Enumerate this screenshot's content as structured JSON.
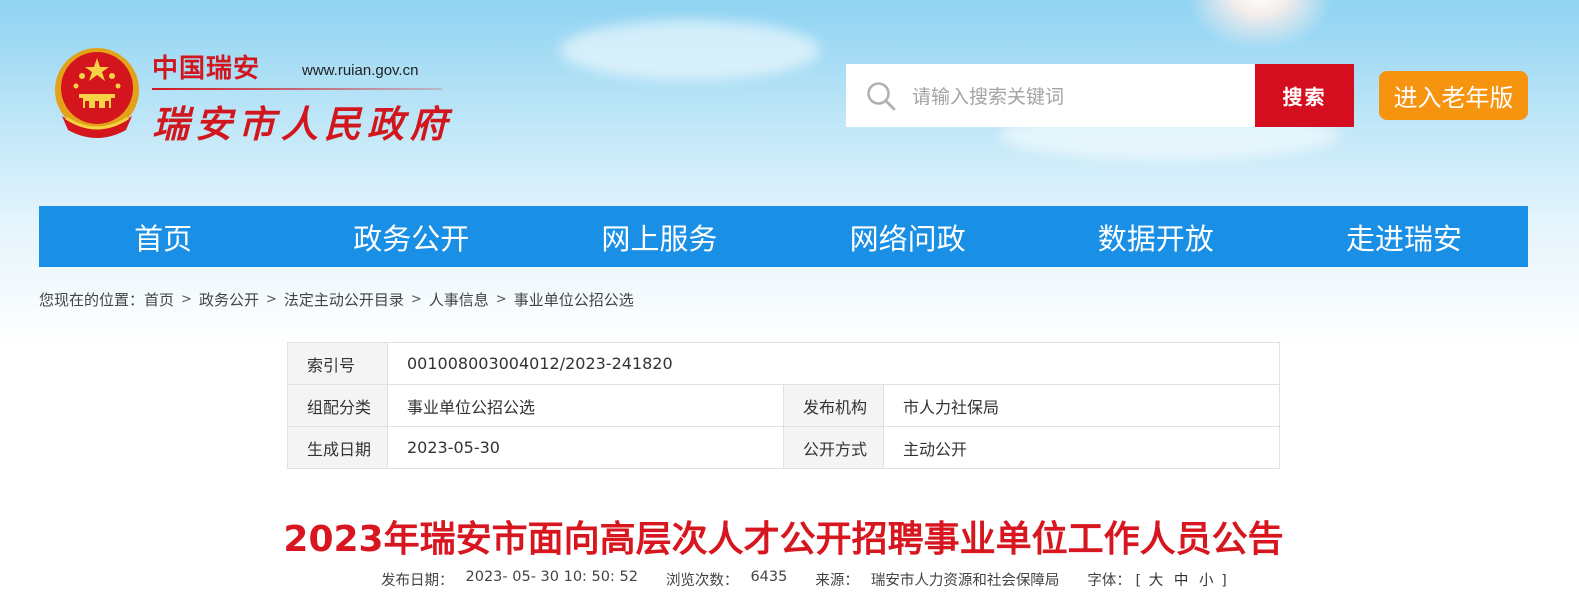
{
  "header": {
    "site_title_top": "中国瑞安",
    "site_url": "www.ruian.gov.cn",
    "site_title_main": "瑞安市人民政府",
    "search_placeholder": "请输入搜索关键词",
    "search_button": "搜索",
    "elder_button": "进入老年版"
  },
  "nav": [
    "首页",
    "政务公开",
    "网上服务",
    "网络问政",
    "数据开放",
    "走进瑞安"
  ],
  "breadcrumb": {
    "prefix": "您现在的位置：",
    "items": [
      "首页",
      "政务公开",
      "法定主动公开目录",
      "人事信息",
      "事业单位公招公选"
    ],
    "separator": ">"
  },
  "info_table": {
    "index_label": "索引号",
    "index_value": "001008003004012/2023-241820",
    "category_label": "组配分类",
    "category_value": "事业单位公招公选",
    "publisher_label": "发布机构",
    "publisher_value": "市人力社保局",
    "date_label": "生成日期",
    "date_value": "2023-05-30",
    "method_label": "公开方式",
    "method_value": "主动公开"
  },
  "article": {
    "title": "2023年瑞安市面向高层次人才公开招聘事业单位工作人员公告",
    "publish_date_label": "发布日期：",
    "publish_date": "2023- 05- 30 10: 50: 52",
    "views_label": "浏览次数：",
    "views": "6435",
    "source_label": "来源：",
    "source": "瑞安市人力资源和社会保障局",
    "font_label": "字体：",
    "font_open": "[",
    "font_large": "大",
    "font_medium": "中",
    "font_small": "小",
    "font_close": "]"
  },
  "colors": {
    "brand_red": "#d40e1e",
    "nav_blue": "#1a8fe6",
    "elder_orange": "#f7940f",
    "title_red": "#d7161f"
  }
}
